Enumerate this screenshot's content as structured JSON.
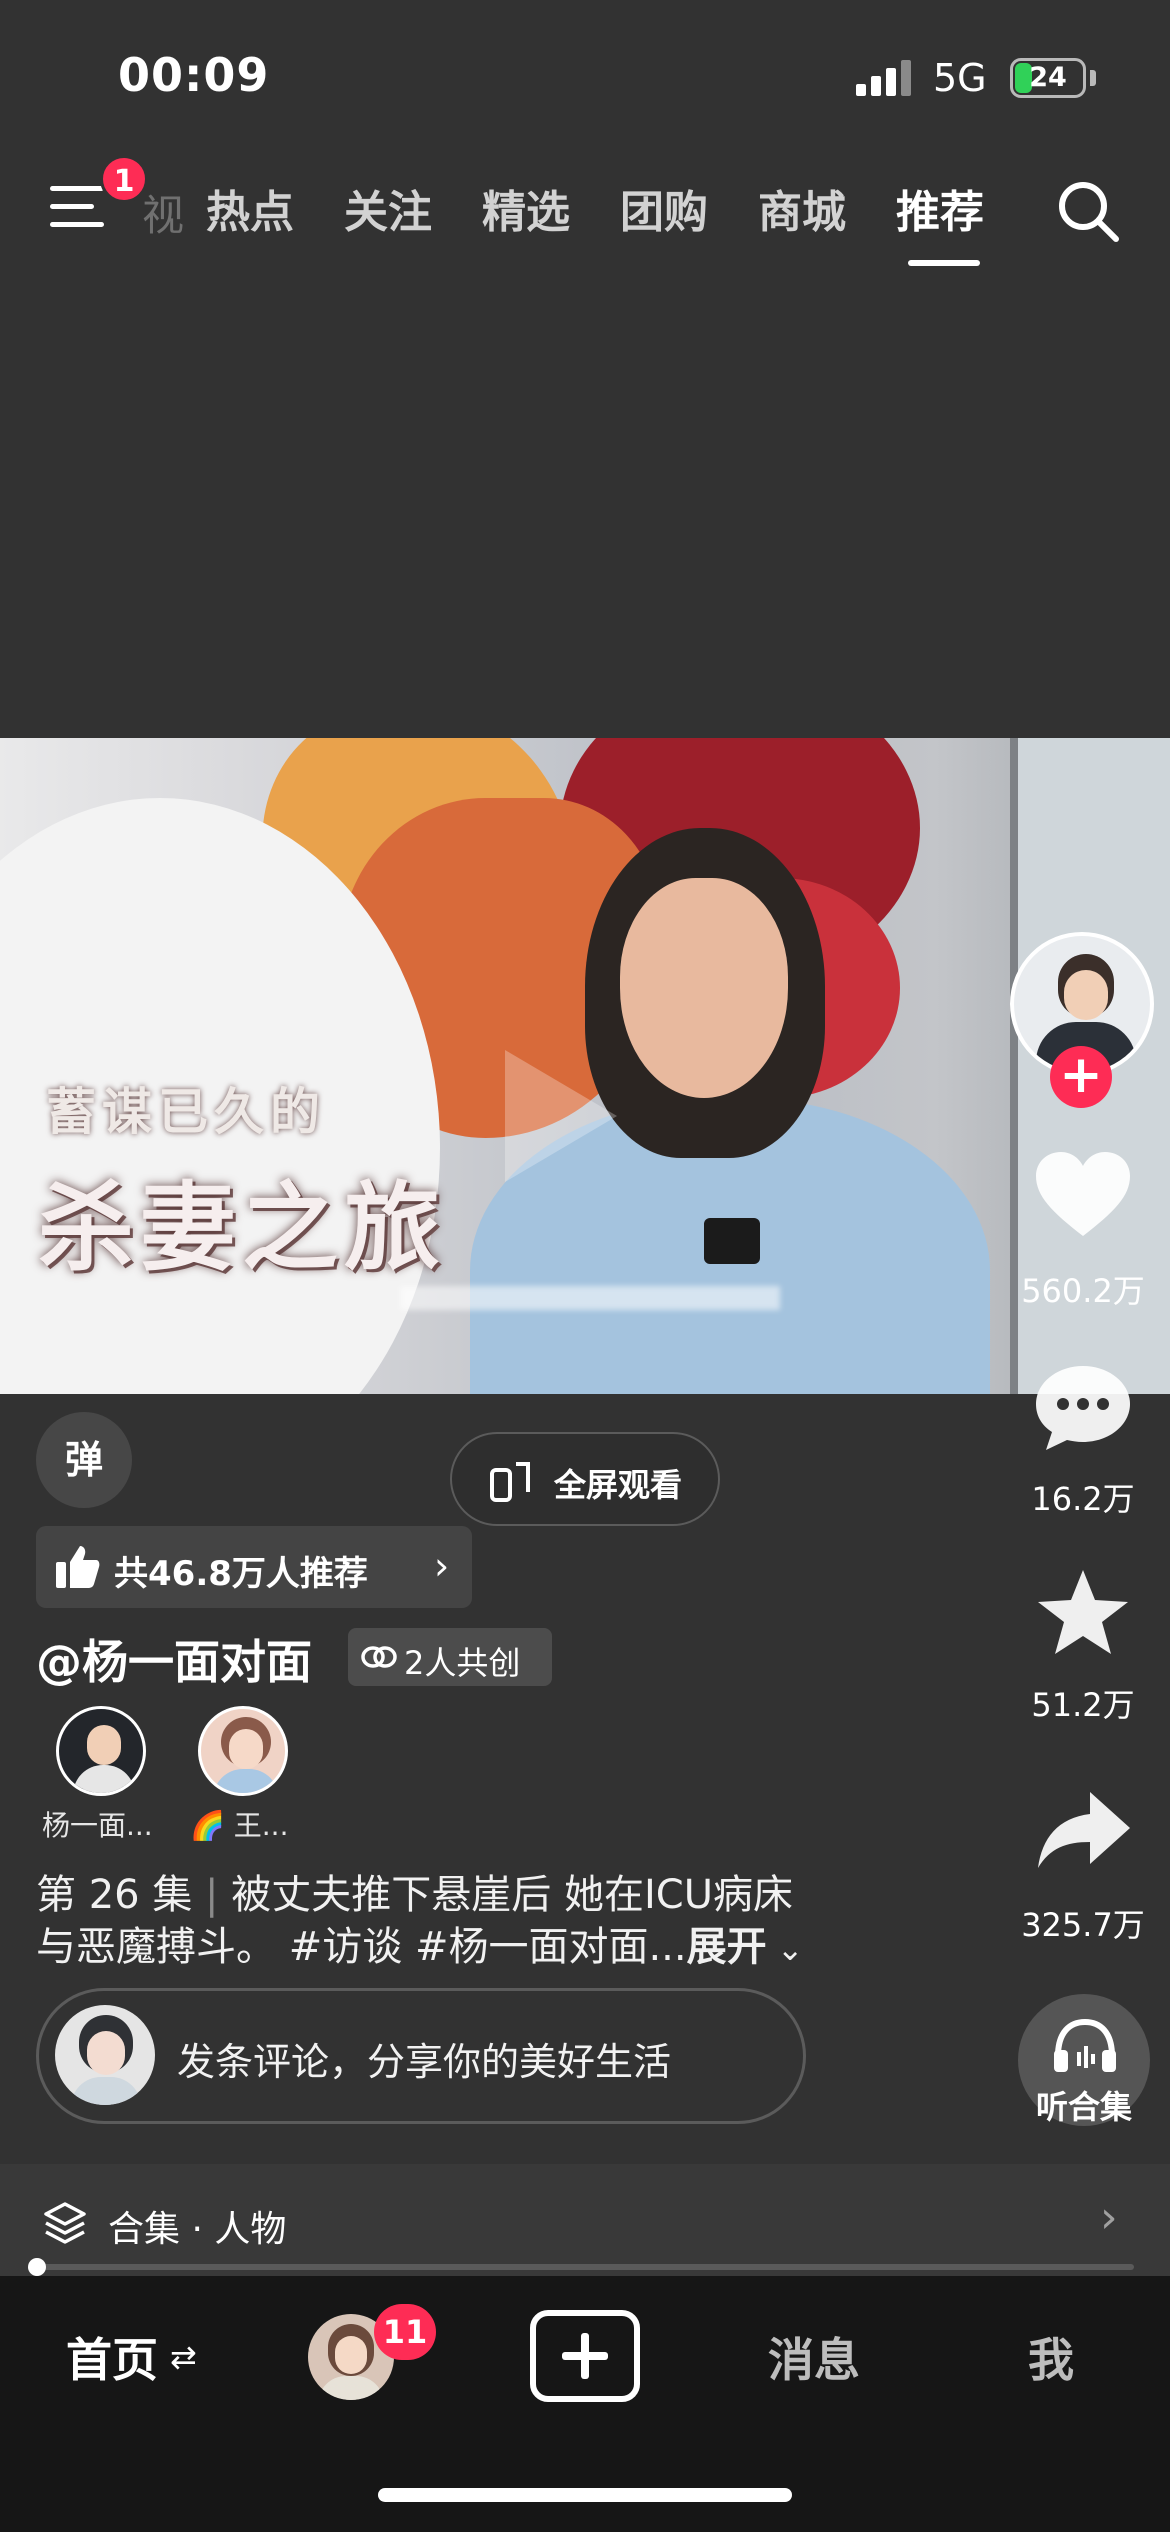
{
  "status_bar": {
    "time": "00:09",
    "network": "5G",
    "battery": "24",
    "battery_level": 0.24
  },
  "top_nav": {
    "menu_badge": "1",
    "ghost_tab": "视",
    "tabs": [
      "热点",
      "关注",
      "精选",
      "团购",
      "商城",
      "推荐"
    ],
    "active_tab": "推荐"
  },
  "video": {
    "overlay_line1": "蓄谋已久的",
    "overlay_line2": "杀妻之旅"
  },
  "rail": {
    "likes": "560.2万",
    "comments": "16.2万",
    "favorites": "51.2万",
    "shares": "325.7万",
    "listen_label": "听合集"
  },
  "info": {
    "danmu_label": "弹",
    "fullscreen_label": "全屏观看",
    "recommend_text": "共46.8万人推荐",
    "author": "@杨一面对面",
    "cocreate": "2人共创",
    "co_creators": [
      {
        "name": "杨一面..."
      },
      {
        "name": "🌈 王..."
      }
    ],
    "episode": "第 26 集",
    "desc_line1": "被丈夫推下悬崖后 她在ICU病床",
    "desc_line2": "与恶魔搏斗。 #访谈 #杨一面对面...",
    "expand": "展开"
  },
  "comment_bar": {
    "placeholder": "发条评论，分享你的美好生活"
  },
  "collection": {
    "label": "合集 · 人物"
  },
  "tabbar": {
    "home": "首页",
    "badge": "11",
    "messages": "消息",
    "me": "我"
  }
}
